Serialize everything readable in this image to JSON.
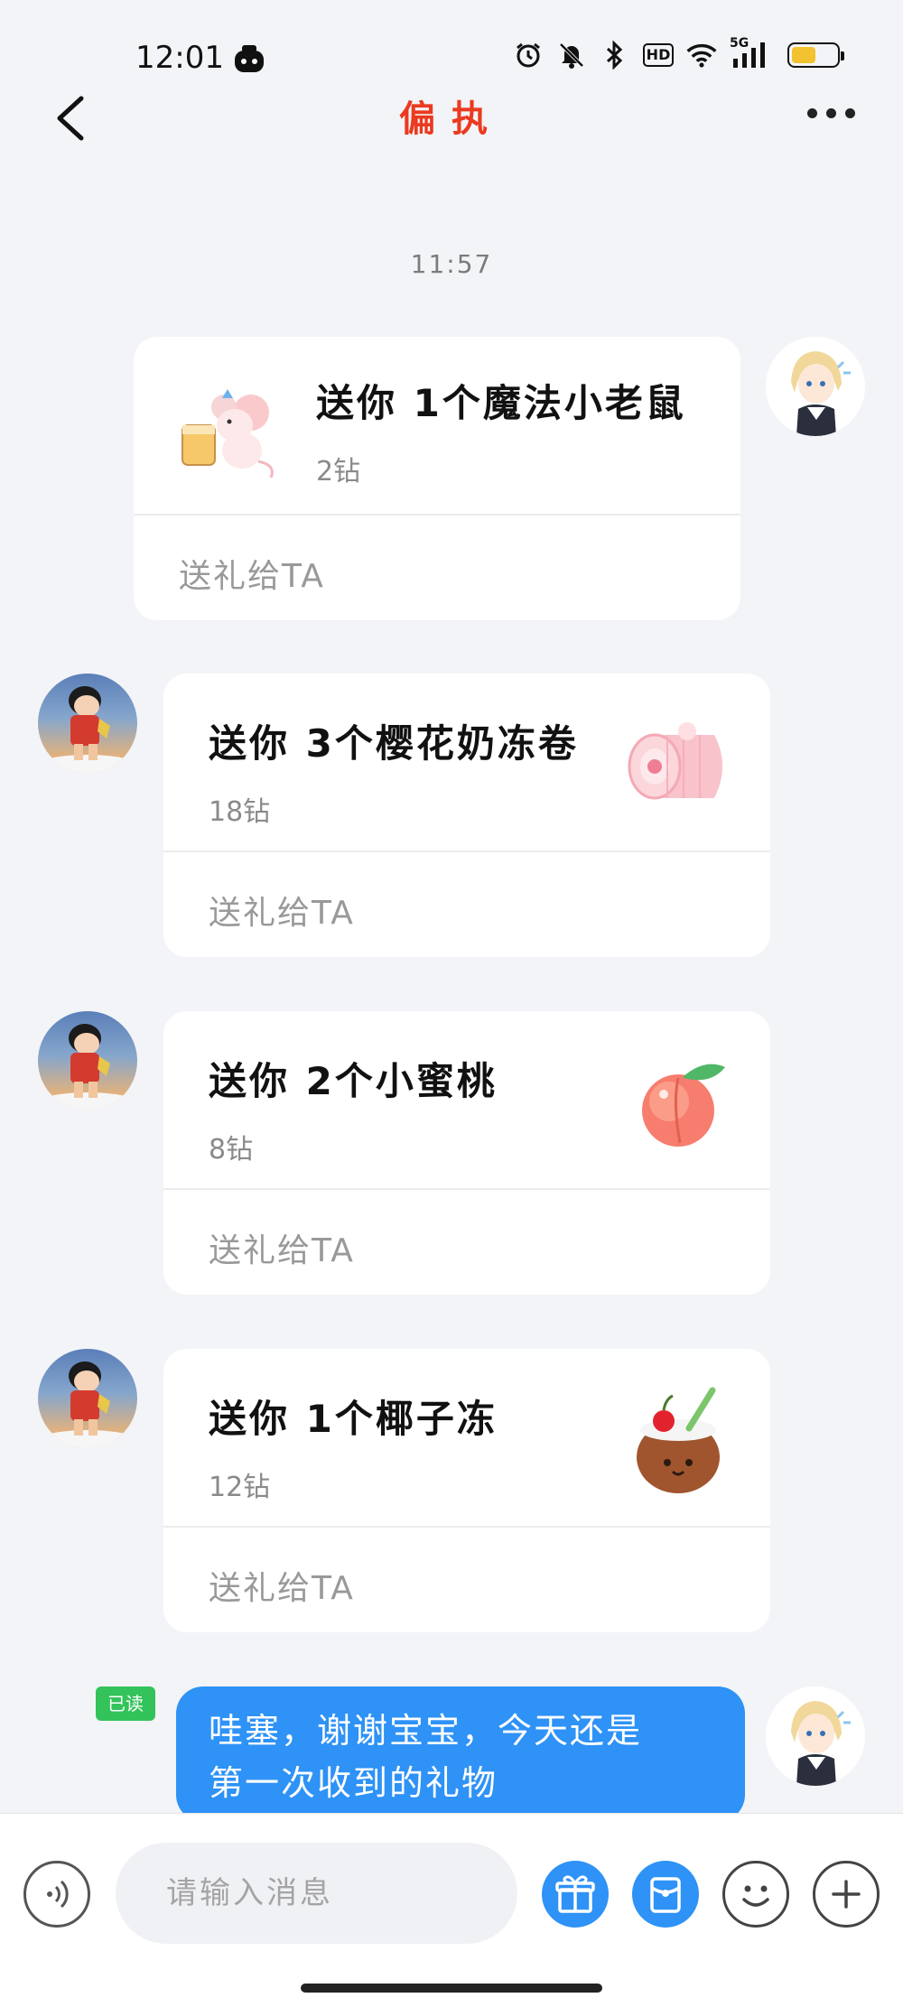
{
  "status_bar": {
    "time": "12:01",
    "network_label": "5G",
    "hd_label": "HD",
    "battery_level": 0.55,
    "icons": [
      "app-icon",
      "alarm-icon",
      "mute-icon",
      "bluetooth-icon",
      "hd-icon",
      "wifi-icon",
      "signal-icon",
      "battery-icon"
    ]
  },
  "header": {
    "title": "偏执",
    "back_icon": "chevron-left-icon",
    "more_icon": "more-icon"
  },
  "chat": {
    "timestamp": "11:57",
    "messages": [
      {
        "sender": "me",
        "type": "gift",
        "title": "送你 1个魔法小老鼠",
        "price": "2钻",
        "action": "送礼给TA",
        "gift_icon": "magic-mouse-icon"
      },
      {
        "sender": "other",
        "type": "gift",
        "title": "送你 3个樱花奶冻卷",
        "price": "18钻",
        "action": "送礼给TA",
        "gift_icon": "sakura-roll-icon"
      },
      {
        "sender": "other",
        "type": "gift",
        "title": "送你 2个小蜜桃",
        "price": "8钻",
        "action": "送礼给TA",
        "gift_icon": "peach-icon"
      },
      {
        "sender": "other",
        "type": "gift",
        "title": "送你 1个椰子冻",
        "price": "12钻",
        "action": "送礼给TA",
        "gift_icon": "coconut-icon"
      },
      {
        "sender": "me",
        "type": "text",
        "read_label": "已读",
        "text_line1": "哇塞，谢谢宝宝，今天还是",
        "text_line2": "第一次收到的礼物"
      }
    ]
  },
  "input_bar": {
    "placeholder": "请输入消息",
    "value": "",
    "buttons": [
      "voice-icon",
      "gift-icon",
      "red-packet-icon",
      "emoji-icon",
      "plus-icon"
    ]
  },
  "colors": {
    "title": "#ea3a20",
    "bubble": "#2e92f6",
    "read_badge": "#33c35a",
    "background": "#f3f4f7"
  }
}
